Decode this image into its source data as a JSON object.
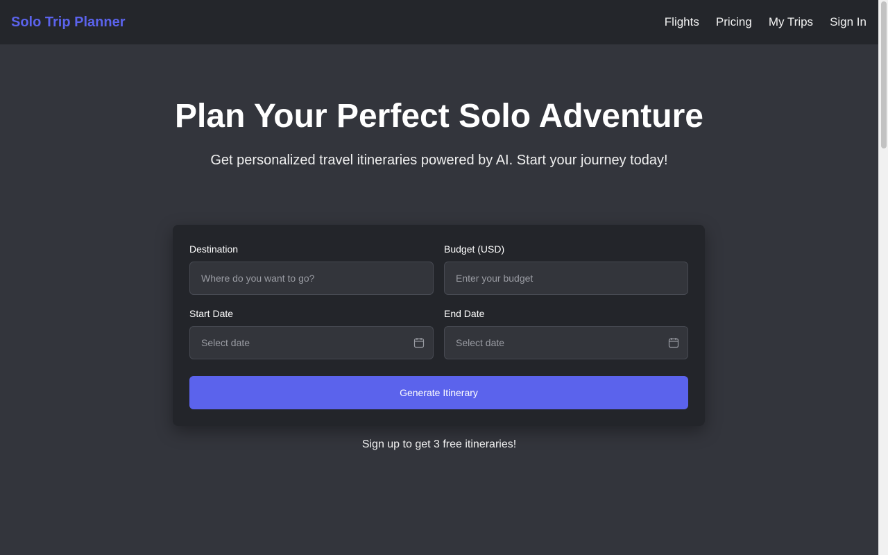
{
  "header": {
    "brand": "Solo Trip Planner",
    "nav": [
      {
        "label": "Flights"
      },
      {
        "label": "Pricing"
      },
      {
        "label": "My Trips"
      },
      {
        "label": "Sign In"
      }
    ]
  },
  "hero": {
    "title": "Plan Your Perfect Solo Adventure",
    "subtitle": "Get personalized travel itineraries powered by AI. Start your journey today!"
  },
  "form": {
    "destination": {
      "label": "Destination",
      "placeholder": "Where do you want to go?",
      "value": ""
    },
    "budget": {
      "label": "Budget (USD)",
      "placeholder": "Enter your budget",
      "value": ""
    },
    "start_date": {
      "label": "Start Date",
      "placeholder": "Select date",
      "value": "",
      "icon": "calendar-icon"
    },
    "end_date": {
      "label": "End Date",
      "placeholder": "Select date",
      "value": "",
      "icon": "calendar-icon"
    },
    "submit_label": "Generate Itinerary"
  },
  "signup_note": "Sign up to get 3 free itineraries!",
  "colors": {
    "accent": "#5b63ec",
    "background": "#33353c",
    "navbar": "#24262b",
    "card": "#23252a"
  }
}
